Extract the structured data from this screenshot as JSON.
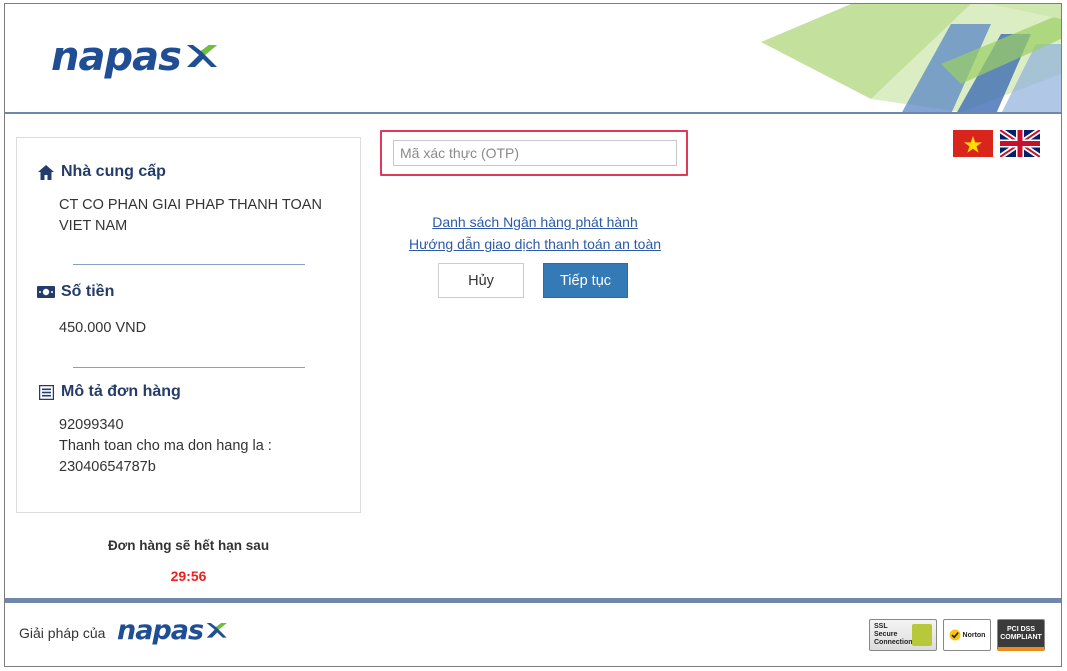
{
  "header": {
    "logo_text": "napas"
  },
  "provider": {
    "title": "Nhà cung cấp",
    "name": "CT CO PHAN GIAI PHAP THANH TOAN VIET NAM"
  },
  "amount": {
    "title": "Số tiền",
    "value": "450.000 VND"
  },
  "order": {
    "title": "Mô tả đơn hàng",
    "id": "92099340",
    "description": "Thanh toan cho ma don hang la : 23040654787b"
  },
  "expiry": {
    "label": "Đơn hàng sẽ hết hạn sau",
    "timer": "29:56"
  },
  "form": {
    "otp_placeholder": "Mã xác thực (OTP)",
    "otp_value": "",
    "link_banks": "Danh sách Ngân hàng phát hành",
    "link_guide": "Hướng dẫn giao dịch thanh toán an toàn",
    "cancel_label": "Hủy",
    "continue_label": "Tiếp tục"
  },
  "languages": [
    "vietnamese-flag",
    "english-flag"
  ],
  "footer": {
    "text": "Giải pháp của",
    "logo_text": "napas",
    "badges": {
      "ssl": "SSL Secure Connection",
      "norton": "Norton",
      "pci": "PCI DSS COMPLIANT"
    }
  },
  "colors": {
    "brand_blue": "#1f4e95",
    "brand_green": "#6fbf3a",
    "rule": "#6f87ab",
    "primary_button": "#337ab7",
    "otp_border": "#e0375b",
    "timer": "#e8231f"
  }
}
